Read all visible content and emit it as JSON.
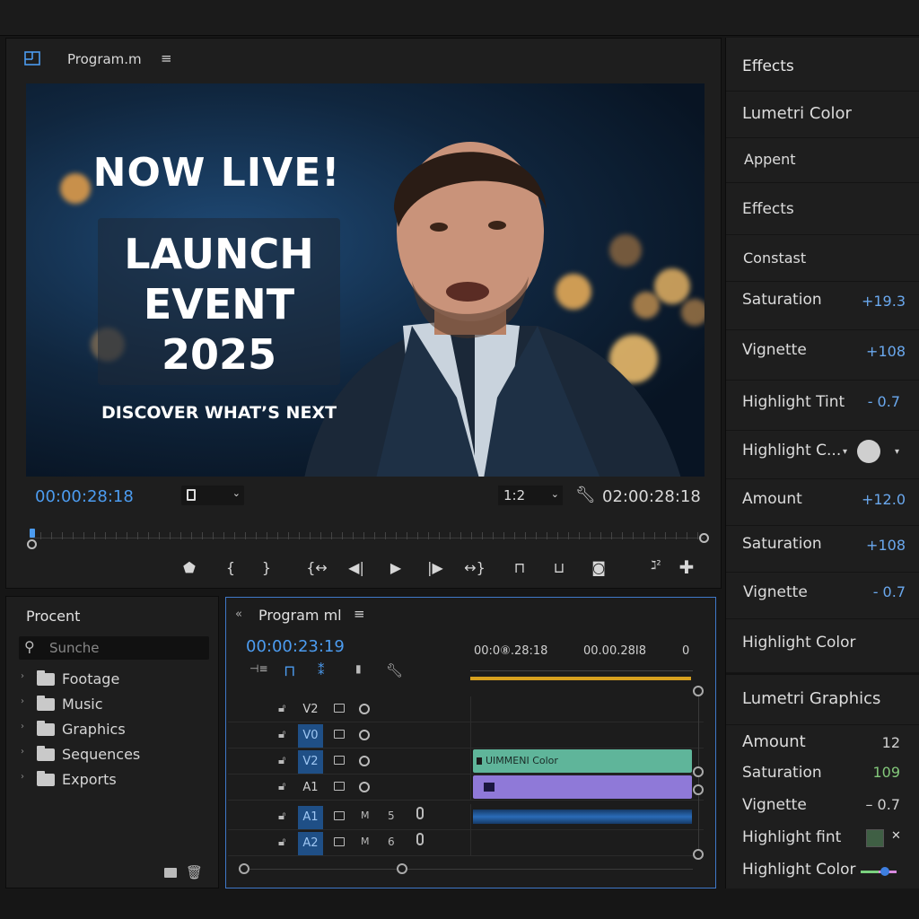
{
  "program_monitor": {
    "title": "Program.m",
    "menu_icon": "hamburger-icon",
    "video_text": {
      "headline": "NOW LIVE!",
      "title_line1": "LAUNCH",
      "title_line2": "EVENT",
      "title_line3": "2025",
      "tagline": "DISCOVER WHAT’S NEXT"
    },
    "timecode_current": "00:00:28:18",
    "timecode_duration": "02:00:28:18",
    "zoom": "1:2",
    "playhead_position": 0.0
  },
  "project": {
    "title": "Procent",
    "search_placeholder": "Sunche",
    "bins": [
      "Footage",
      "Music",
      "Graphics",
      "Sequences",
      "Exports"
    ]
  },
  "timeline": {
    "title": "Program ml",
    "timecode": "00:00:23:19",
    "ruler_labels": [
      "00:0⑧.28:18",
      "00.00.28I8",
      "0"
    ],
    "tracks": [
      {
        "name": "V2",
        "active": false,
        "type": "video"
      },
      {
        "name": "V0",
        "active": true,
        "type": "video"
      },
      {
        "name": "V2",
        "active": true,
        "type": "video",
        "clip": "UIMMENI Color"
      },
      {
        "name": "A1",
        "active": false,
        "type": "video"
      },
      {
        "name": "A1",
        "active": true,
        "type": "audio",
        "m": "M",
        "num": "5"
      },
      {
        "name": "A2",
        "active": true,
        "type": "audio",
        "m": "M",
        "num": "6"
      }
    ]
  },
  "effects": {
    "header": "Effects",
    "section1": "Lumetri Color",
    "appent": "Appent",
    "effects2": "Effects",
    "constast": "Constast",
    "params": [
      {
        "label": "Saturation",
        "value": "+19.3"
      },
      {
        "label": "Vignette",
        "value": "+108"
      },
      {
        "label": "Highlight Tint",
        "value": "- 0.7"
      },
      {
        "label": "Highlight C...",
        "value": ""
      },
      {
        "label": "Amount",
        "value": "+12.0"
      },
      {
        "label": "Saturation",
        "value": "+108"
      },
      {
        "label": "Vignette",
        "value": "- 0.7"
      },
      {
        "label": "Highlight Color",
        "value": ""
      }
    ],
    "section2": "Lumetri Graphics",
    "params2": [
      {
        "label": "Amount",
        "value": "12"
      },
      {
        "label": "Saturation",
        "value": "109"
      },
      {
        "label": "Vignette",
        "value": "– 0.7"
      },
      {
        "label": "Highlight fint",
        "value": ""
      },
      {
        "label": "Highlight Color",
        "value": ""
      }
    ]
  },
  "colors": {
    "accent_blue": "#4c9cf0",
    "timeline_bar": "#d8a11f",
    "clip_teal": "#5fb59a",
    "clip_purple": "#8f79d8"
  }
}
